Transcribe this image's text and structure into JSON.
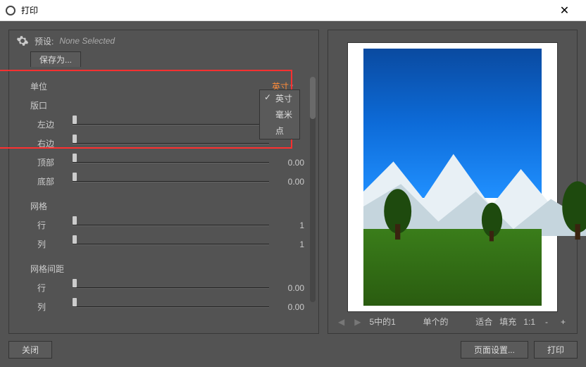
{
  "window": {
    "title": "打印"
  },
  "preset": {
    "label": "预设:",
    "value": "None Selected",
    "saveas": "保存为..."
  },
  "unit": {
    "label": "单位",
    "value": "英寸",
    "options": [
      "英寸",
      "毫米",
      "点"
    ],
    "selected": "英寸"
  },
  "viewport": {
    "label": "版口",
    "left": {
      "label": "左边",
      "value": ""
    },
    "right": {
      "label": "右边",
      "value": ""
    },
    "top": {
      "label": "顶部",
      "value": "0.00"
    },
    "bottom": {
      "label": "底部",
      "value": "0.00"
    }
  },
  "grid": {
    "label": "网格",
    "rows": {
      "label": "行",
      "value": "1"
    },
    "cols": {
      "label": "列",
      "value": "1"
    }
  },
  "spacing": {
    "label": "网格间距",
    "rows": {
      "label": "行",
      "value": "0.00"
    },
    "cols": {
      "label": "列",
      "value": "0.00"
    }
  },
  "preview": {
    "page_counter": "5中的1",
    "mode": "单个的",
    "fit": "适合",
    "fill": "填充",
    "zoom": "1:1",
    "minus": "-",
    "plus": "+"
  },
  "footer": {
    "close": "关闭",
    "page_setup": "页面设置...",
    "print": "打印"
  }
}
